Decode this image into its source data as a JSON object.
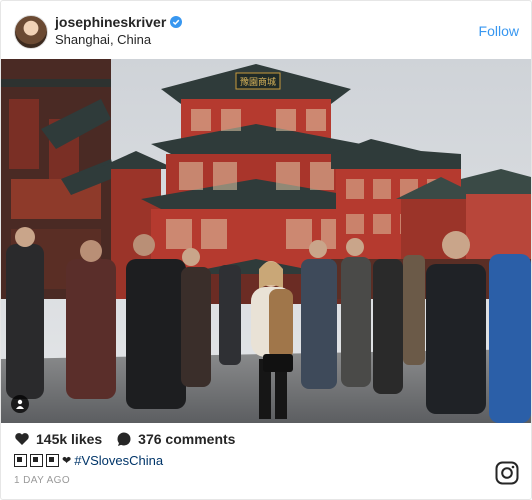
{
  "header": {
    "username": "josephineskriver",
    "verified": true,
    "location": "Shanghai, China",
    "follow_label": "Follow"
  },
  "photo": {
    "sign_text": "豫園商城"
  },
  "stats": {
    "likes": "145k likes",
    "comments": "376 comments"
  },
  "caption": {
    "hashtag": "#VSlovesChina"
  },
  "timestamp": "1 DAY AGO",
  "colors": {
    "link": "#3897f0",
    "hashtag": "#003569",
    "timestamp": "#999999",
    "verified": "#3897f0",
    "roof": "#2f3b3a",
    "facade": "#b53a2f"
  },
  "icons": [
    "verified-badge-icon",
    "heart-icon",
    "comment-icon",
    "instagram-logo-icon",
    "user-tag-icon"
  ]
}
